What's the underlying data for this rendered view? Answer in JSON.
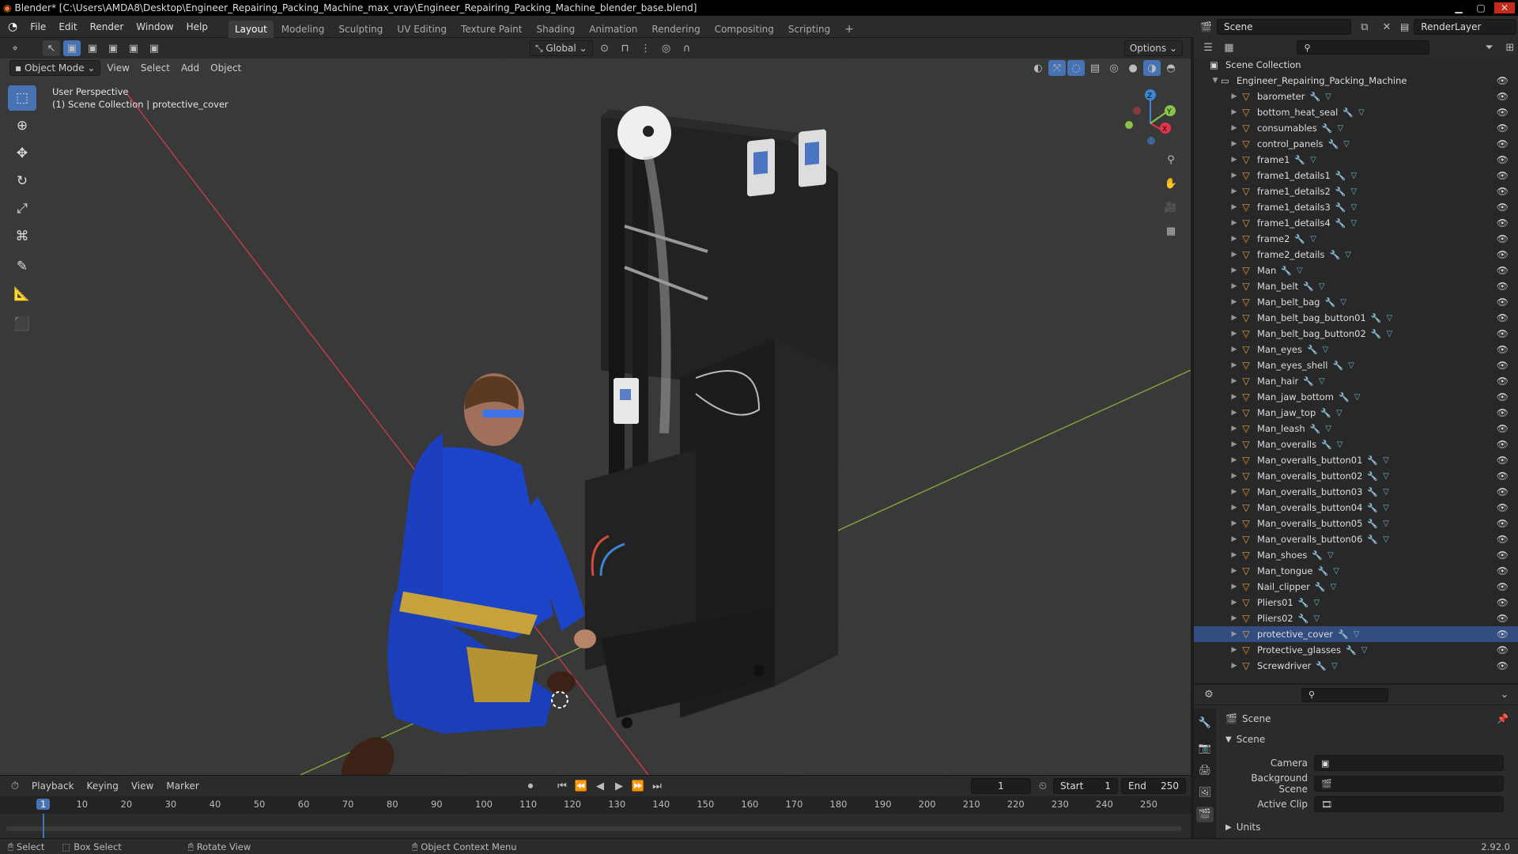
{
  "window": {
    "title": "Blender* [C:\\Users\\AMDA8\\Desktop\\Engineer_Repairing_Packing_Machine_max_vray\\Engineer_Repairing_Packing_Machine_blender_base.blend]"
  },
  "menus": [
    "File",
    "Edit",
    "Render",
    "Window",
    "Help"
  ],
  "workspaces": [
    "Layout",
    "Modeling",
    "Sculpting",
    "UV Editing",
    "Texture Paint",
    "Shading",
    "Animation",
    "Rendering",
    "Compositing",
    "Scripting"
  ],
  "active_workspace": "Layout",
  "scene_selector": {
    "scene": "Scene",
    "view_layer": "RenderLayer"
  },
  "viewport_header": {
    "transform_orientation": "Global",
    "options_label": "Options",
    "mode": "Object Mode",
    "menus": [
      "View",
      "Select",
      "Add",
      "Object"
    ]
  },
  "viewport_overlay": {
    "perspective": "User Perspective",
    "context": "(1) Scene Collection | protective_cover"
  },
  "gizmo_axes": {
    "x": "X",
    "y": "Y",
    "z": "Z"
  },
  "colors": {
    "accent": "#4772b3",
    "x_axis": "#e8334d",
    "y_axis": "#8bc34a",
    "z_axis": "#3d87d6",
    "mesh_icon": "#e59d45"
  },
  "outliner": {
    "root": "Scene Collection",
    "collection": "Engineer_Repairing_Packing_Machine",
    "items": [
      "barometer",
      "bottom_heat_seal",
      "consumables",
      "control_panels",
      "frame1",
      "frame1_details1",
      "frame1_details2",
      "frame1_details3",
      "frame1_details4",
      "frame2",
      "frame2_details",
      "Man",
      "Man_belt",
      "Man_belt_bag",
      "Man_belt_bag_button01",
      "Man_belt_bag_button02",
      "Man_eyes",
      "Man_eyes_shell",
      "Man_hair",
      "Man_jaw_bottom",
      "Man_jaw_top",
      "Man_leash",
      "Man_overalls",
      "Man_overalls_button01",
      "Man_overalls_button02",
      "Man_overalls_button03",
      "Man_overalls_button04",
      "Man_overalls_button05",
      "Man_overalls_button06",
      "Man_shoes",
      "Man_tongue",
      "Nail_clipper",
      "Pliers01",
      "Pliers02",
      "protective_cover",
      "Protective_glasses",
      "Screwdriver"
    ],
    "active_item": "protective_cover"
  },
  "properties": {
    "context": "Scene",
    "panel": "Scene",
    "camera_label": "Camera",
    "background_label": "Background Scene",
    "clip_label": "Active Clip",
    "units_panel": "Units"
  },
  "timeline": {
    "menus": [
      "Playback",
      "Keying",
      "View",
      "Marker"
    ],
    "current_frame": "1",
    "start_label": "Start",
    "start": "1",
    "end_label": "End",
    "end": "250",
    "ruler": [
      "1",
      "10",
      "20",
      "30",
      "40",
      "50",
      "60",
      "70",
      "80",
      "90",
      "100",
      "110",
      "120",
      "130",
      "140",
      "150",
      "160",
      "170",
      "180",
      "190",
      "200",
      "210",
      "220",
      "230",
      "240",
      "250"
    ]
  },
  "statusbar": {
    "select": "Select",
    "box_select": "Box Select",
    "rotate": "Rotate View",
    "context_menu": "Object Context Menu",
    "version": "2.92.0"
  }
}
